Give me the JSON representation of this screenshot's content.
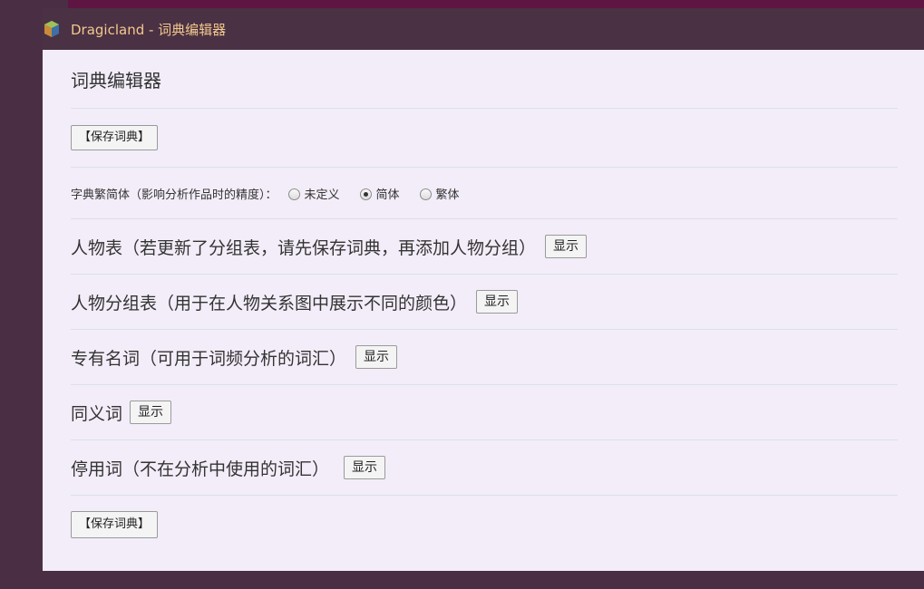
{
  "window": {
    "title": "Dragicland - 词典编辑器"
  },
  "page": {
    "heading": "词典编辑器",
    "save_button_top": "【保存词典】",
    "save_button_bottom": "【保存词典】"
  },
  "script_type": {
    "label": "字典繁简体（影响分析作品时的精度）：",
    "options": [
      {
        "label": "未定义",
        "selected": false
      },
      {
        "label": "简体",
        "selected": true
      },
      {
        "label": "繁体",
        "selected": false
      }
    ]
  },
  "sections": [
    {
      "label": "人物表（若更新了分组表，请先保存词典，再添加人物分组）",
      "button": "显示"
    },
    {
      "label": "人物分组表（用于在人物关系图中展示不同的颜色）",
      "button": "显示"
    },
    {
      "label": "专有名词（可用于词频分析的词汇）",
      "button": "显示"
    },
    {
      "label": "同义词",
      "button": "显示"
    },
    {
      "label": "停用词（不在分析中使用的词汇）",
      "button": "显示"
    }
  ],
  "colors": {
    "title_text": "#f2c98d",
    "panel_bg": "#f3edf9",
    "frame_bg": "#4a2f44"
  },
  "icons": {
    "app": "dragicland-app-icon"
  }
}
